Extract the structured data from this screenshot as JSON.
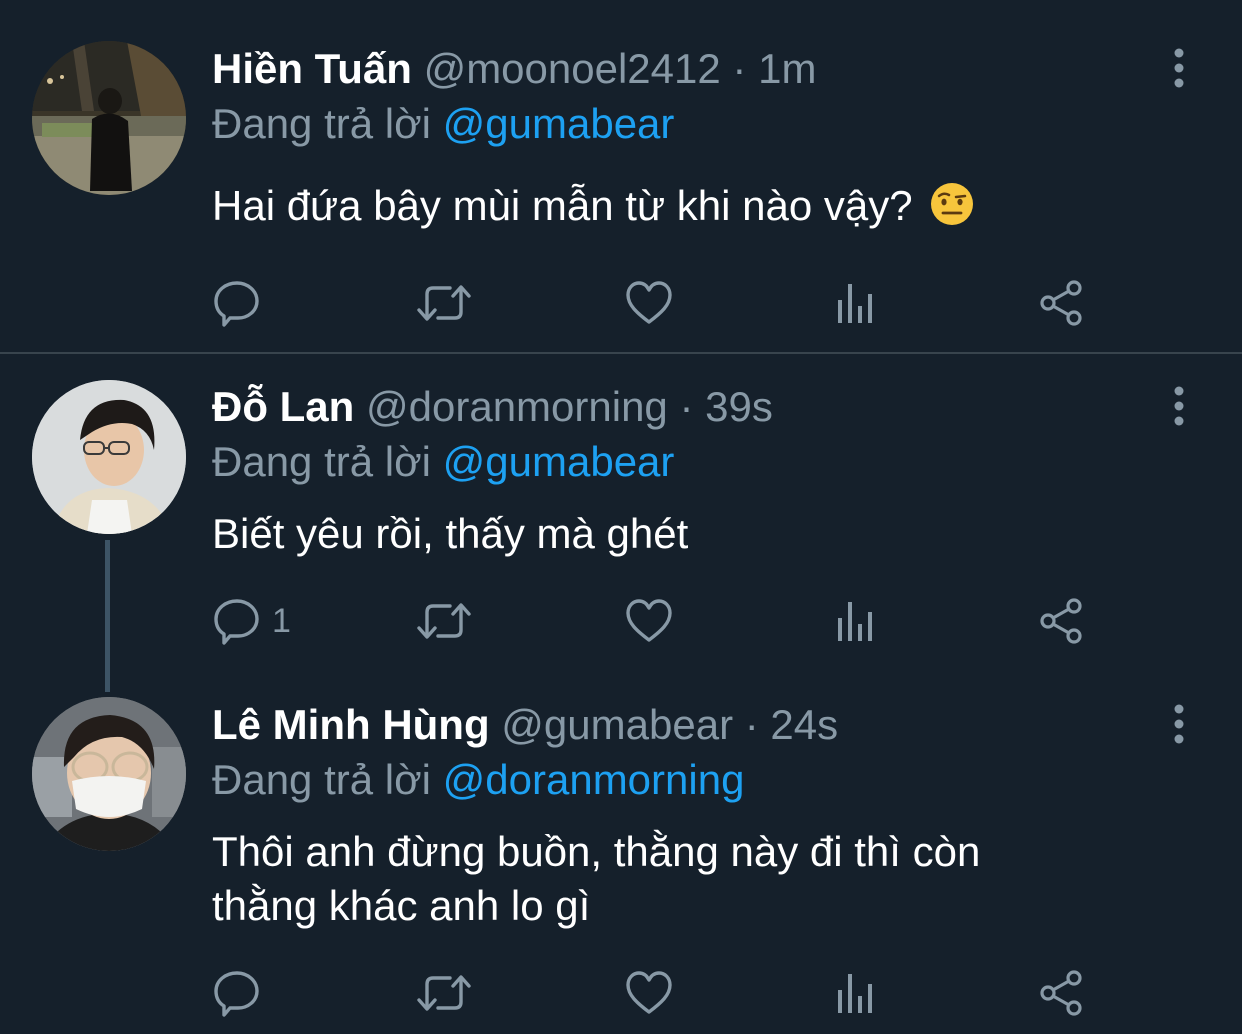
{
  "tweets": [
    {
      "name": "Hiền Tuấn",
      "handle": "@moonoel2412",
      "separator": "·",
      "time": "1m",
      "replying_label": "Đang trả lời",
      "replying_to": "@gumabear",
      "text": "Hai đứa bây mùi mẫn từ khi nào vậy?",
      "emoji": "face-with-raised-eyebrow",
      "reply_count": ""
    },
    {
      "name": "Đỗ Lan",
      "handle": "@doranmorning",
      "separator": "·",
      "time": "39s",
      "replying_label": "Đang trả lời",
      "replying_to": "@gumabear",
      "text": "Biết yêu rồi, thấy mà ghét",
      "reply_count": "1"
    },
    {
      "name": "Lê Minh Hùng",
      "handle": "@gumabear",
      "separator": "·",
      "time": "24s",
      "replying_label": "Đang trả lời",
      "replying_to": "@doranmorning",
      "text_line1": "Thôi anh đừng buồn, thằng này đi thì còn",
      "text_line2": "thằng khác anh lo gì",
      "reply_count": ""
    }
  ],
  "icons": {
    "reply": "reply-icon",
    "retweet": "retweet-icon",
    "like": "heart-icon",
    "stats": "stats-icon",
    "share": "share-icon",
    "more": "more-vertical-icon"
  },
  "colors": {
    "background": "#15202b",
    "link": "#1da1f2",
    "secondary_text": "#8899a6",
    "divider": "#38444d"
  }
}
